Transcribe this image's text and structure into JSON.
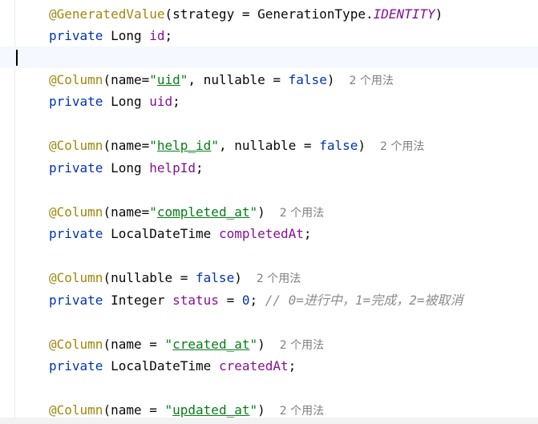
{
  "editor": {
    "lines": {
      "l1": {
        "ann": "@GeneratedValue",
        "p1": "(strategy = GenerationType.",
        "const": "IDENTITY",
        "p2": ")"
      },
      "l2": {
        "kw": "private",
        "type": " Long ",
        "field": "id",
        "end": ";"
      },
      "l4": {
        "ann": "@Column",
        "p1": "(name=",
        "q1": "\"",
        "str": "uid",
        "q2": "\"",
        "p2": ", nullable = ",
        "kw": "false",
        "p3": ")",
        "hint": "2 个用法"
      },
      "l5": {
        "kw": "private",
        "type": " Long ",
        "field": "uid",
        "end": ";"
      },
      "l7": {
        "ann": "@Column",
        "p1": "(name=",
        "q1": "\"",
        "str": "help_id",
        "q2": "\"",
        "p2": ", nullable = ",
        "kw": "false",
        "p3": ")",
        "hint": "2 个用法"
      },
      "l8": {
        "kw": "private",
        "type": " Long ",
        "field": "helpId",
        "end": ";"
      },
      "l10": {
        "ann": "@Column",
        "p1": "(name=",
        "q1": "\"",
        "str": "completed_at",
        "q2": "\"",
        "p3": ")",
        "hint": "2 个用法"
      },
      "l11": {
        "kw": "private",
        "type": " LocalDateTime ",
        "field": "completedAt",
        "end": ";"
      },
      "l13": {
        "ann": "@Column",
        "p1": "(nullable = ",
        "kw": "false",
        "p3": ")",
        "hint": "2 个用法"
      },
      "l14": {
        "kw": "private",
        "type": " Integer ",
        "field": "status",
        "assign": " = ",
        "num": "0",
        "end": ";",
        "comment": " // 0=进行中，1=完成，2=被取消"
      },
      "l16": {
        "ann": "@Column",
        "p1": "(name = ",
        "q1": "\"",
        "str": "created_at",
        "q2": "\"",
        "p3": ")",
        "hint": "2 个用法"
      },
      "l17": {
        "kw": "private",
        "type": " LocalDateTime ",
        "field": "createdAt",
        "end": ";"
      },
      "l19": {
        "ann": "@Column",
        "p1": "(name = ",
        "q1": "\"",
        "str": "updated_at",
        "q2": "\"",
        "p3": ")",
        "hint": "2 个用法"
      }
    }
  },
  "colors": {
    "annotation": "#9e880d",
    "keyword": "#0033b3",
    "field": "#871094",
    "string": "#067d17",
    "comment": "#8c8c8c",
    "hint": "#7f7f7f",
    "current_line": "#f5f8fe"
  }
}
